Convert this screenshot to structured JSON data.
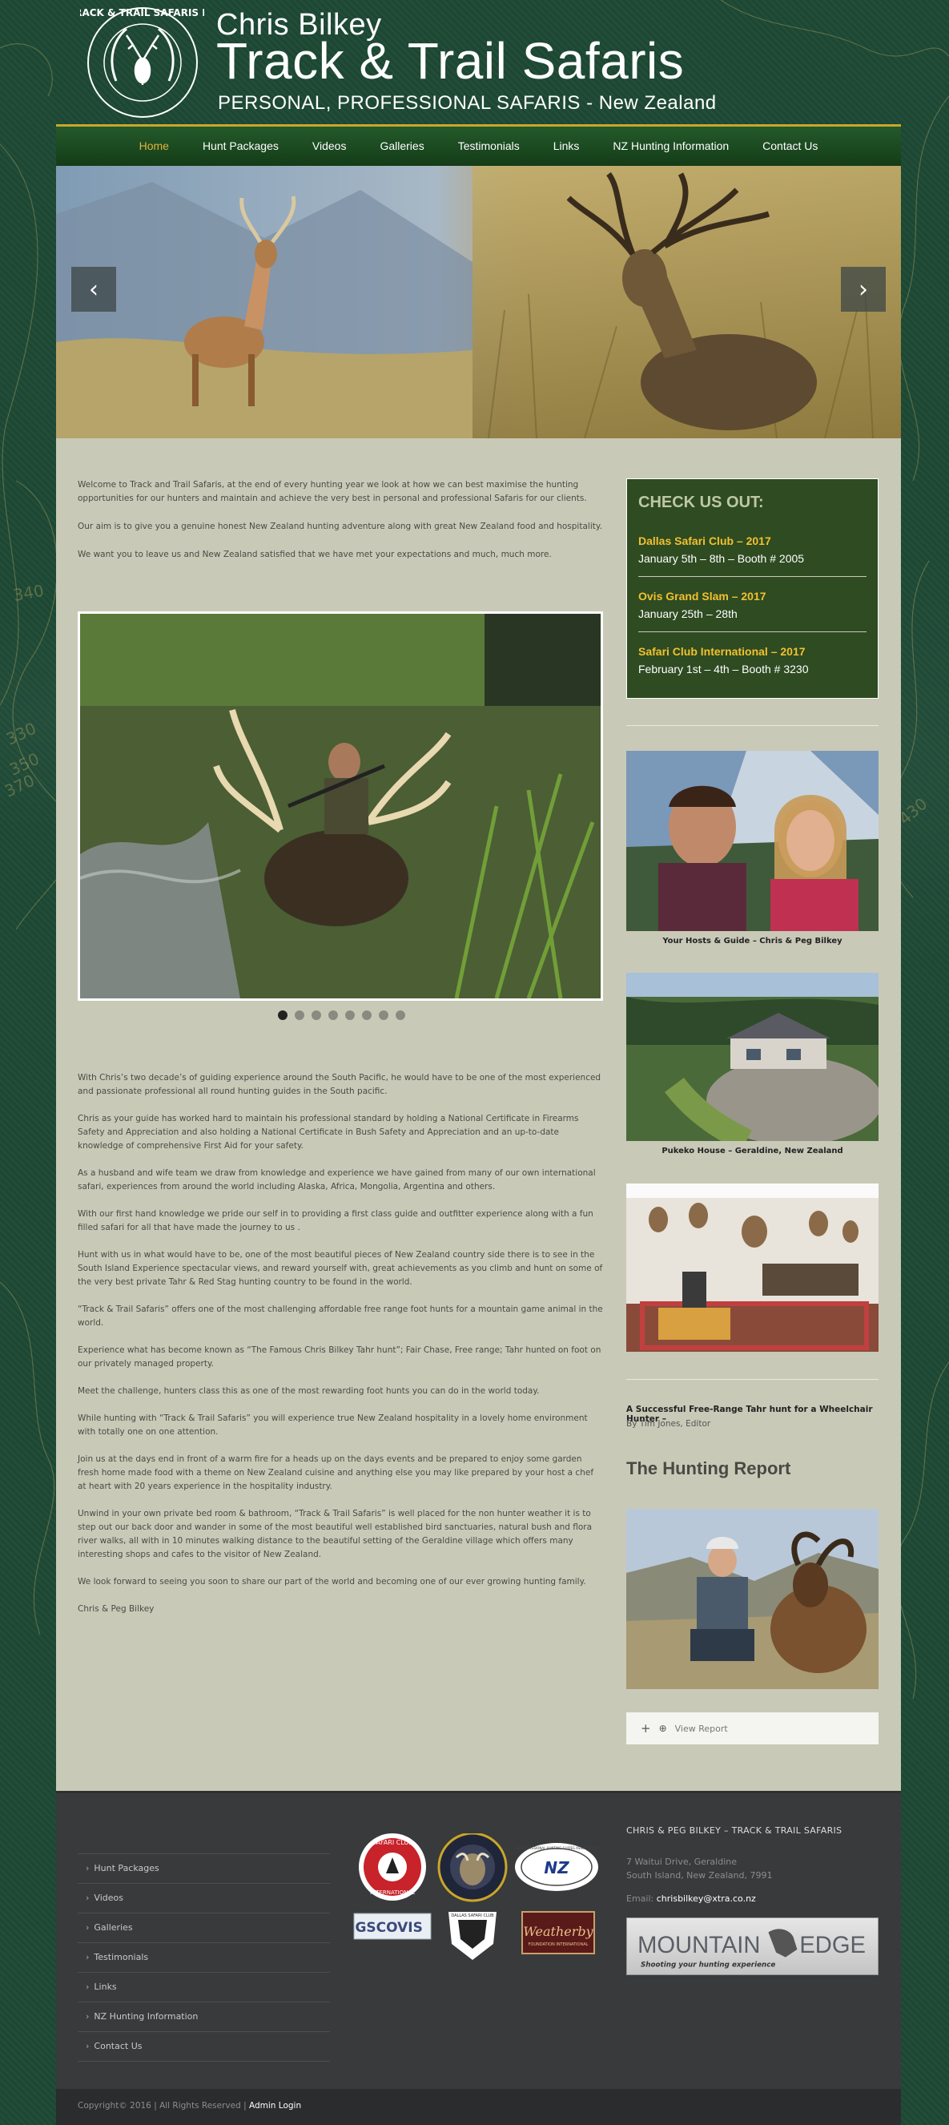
{
  "header": {
    "name_line": "Chris Bilkey",
    "title": "Track & Trail Safaris",
    "tagline": "PERSONAL, PROFESSIONAL SAFARIS -  New Zealand",
    "seal_text": "TRACK & TRAIL SAFARIS NZ"
  },
  "nav": {
    "items": [
      "Home",
      "Hunt Packages",
      "Videos",
      "Galleries",
      "Testimonials",
      "Links",
      "NZ Hunting Information",
      "Contact Us"
    ],
    "active": "Home"
  },
  "slider": {
    "prev": "‹",
    "next": "›"
  },
  "intro": [
    "Welcome to Track and Trail Safaris, at the end of every hunting year we look at how we can best maximise the hunting opportunities for our hunters and maintain and achieve the very best in personal and professional Safaris for our clients.",
    "Our aim is to give you a genuine honest New Zealand hunting adventure along with great New Zealand food and hospitality.",
    "We want you to leave us and New Zealand satisfied that we have met your expectations and much, much more."
  ],
  "gallery": {
    "dot_count": 8,
    "active_dot": 1
  },
  "body": [
    "With Chris’s two decade’s of guiding experience around the South Pacific, he would have to be one of the most experienced and passionate professional all round hunting guides in the South pacific.",
    "Chris as your guide has worked hard to maintain his professional standard by holding a National Certificate in Firearms Safety and Appreciation and also holding a National Certificate in Bush Safety and Appreciation and an up-to-date knowledge of comprehensive First Aid for your safety.",
    "As a husband and wife team we draw from knowledge and experience we have gained from many of our own international safari, experiences from around the world including Alaska, Africa, Mongolia, Argentina and others.",
    "With our first hand knowledge we pride our self in to providing a first class guide and outfitter experience along with a fun filled safari for all that have made the journey to us .",
    "Hunt with us in what would have to be, one of the most beautiful pieces of New Zealand country side there is to see in the South Island Experience spectacular views, and reward yourself with, great achievements as you climb and hunt on some of the very best private Tahr & Red Stag hunting country to be found in the world.",
    "“Track & Trail Safaris” offers one of the most challenging affordable free range foot hunts for a mountain game animal in the world.",
    "Experience what has become known as “The Famous Chris Bilkey Tahr hunt”; Fair Chase, Free range; Tahr hunted on foot on our privately managed property.",
    "Meet the challenge, hunters class this as one of the most rewarding foot hunts you can do in the world today.",
    "While hunting with “Track & Trail Safaris” you will experience true New Zealand hospitality in a lovely home environment with totally one on one attention.",
    "Join us at the days end in front of a warm fire for a heads up on the days events and be prepared to enjoy some garden fresh home made food with a theme on New Zealand cuisine and anything else you may like prepared by your host a chef at heart with 20 years experience in the hospitality industry.",
    "Unwind in your own private bed room & bathroom, “Track & Trail Safaris” is well placed for the non hunter weather it is to step out our back door and wander in some of the most beautiful well established bird sanctuaries, natural bush and flora river walks, all with in 10 minutes walking distance to the beautiful setting of the Geraldine village which offers many interesting shops and cafes to the visitor of New Zealand.",
    "We look forward to seeing you soon to share our part of the world and becoming one of our ever growing hunting family.",
    "Chris & Peg Bilkey"
  ],
  "checkout": {
    "heading": "CHECK US OUT:",
    "events": [
      {
        "title": "Dallas Safari Club – 2017",
        "date": "January 5th – 8th – Booth # 2005"
      },
      {
        "title": "Ovis Grand Slam – 2017",
        "date": "January 25th – 28th"
      },
      {
        "title": "Safari Club International – 2017",
        "date": "February 1st – 4th – Booth # 3230"
      }
    ]
  },
  "captions": {
    "hosts": "Your Hosts & Guide – Chris & Peg Bilkey",
    "house": "Pukeko House – Geraldine, New Zealand"
  },
  "report": {
    "link": "A Successful Free-Range Tahr hunt for a Wheelchair Hunter –",
    "by": "By Tim Jones, Editor",
    "heading": "The Hunting Report",
    "view_label": "View Report"
  },
  "footer": {
    "menu": [
      "Hunt Packages",
      "Videos",
      "Galleries",
      "Testimonials",
      "Links",
      "NZ Hunting Information",
      "Contact Us"
    ],
    "contact_title": "CHRIS & PEG BILKEY – TRACK & TRAIL SAFARIS",
    "address1": "7 Waitui Drive, Geraldine",
    "address2": "South Island, New Zealand, 7991",
    "email_label": "Email: ",
    "email": "chrisbilkey@xtra.co.nz",
    "logos": {
      "sci_line1": "SAFARI CLUB",
      "sci_line2": "INTERNATIONAL",
      "nzpha": "NZ",
      "nzpha_ring": "NZ PROFESSIONAL HUNTING GUIDES ASSOCIATION",
      "gsco": "GSCO",
      "gsco_tail": "VIS",
      "weatherby": "Weatherby",
      "weatherby_sub": "FOUNDATION INTERNATIONAL",
      "dsc": "DALLAS SAFARI CLUB"
    },
    "sponsor_title": "MOUNTAIN",
    "sponsor_title2": "EDGE",
    "sponsor_tag": "Shooting your hunting experience"
  },
  "bottom": {
    "copyright": "Copyright© 2016 | All Rights Reserved | ",
    "admin": "Admin Login"
  },
  "colors": {
    "nav_active": "#e2b33a",
    "gold_accent": "#f2c12e",
    "content_bg": "#c9c9b8",
    "footer_bg": "#383a3b"
  }
}
